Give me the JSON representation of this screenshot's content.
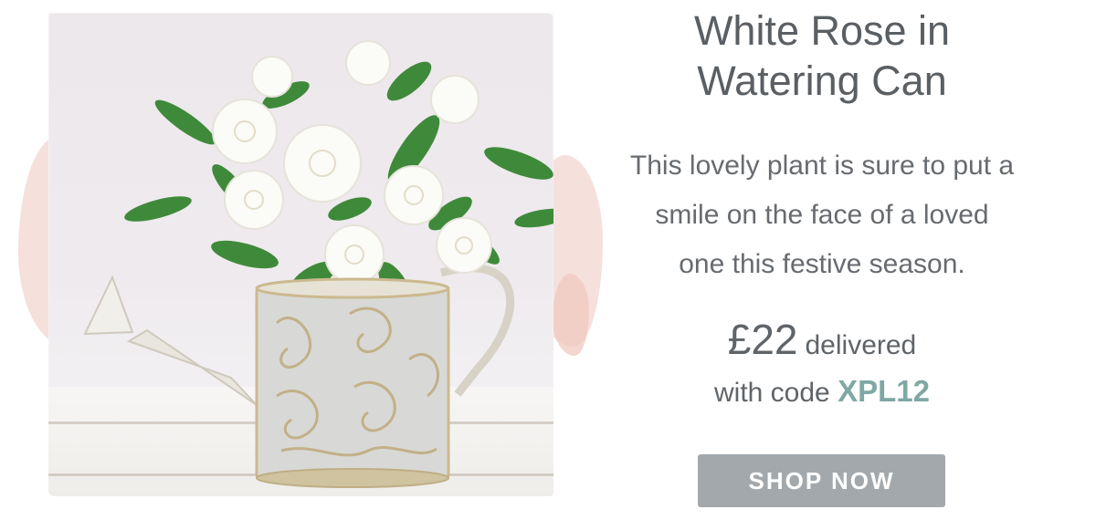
{
  "product": {
    "title_line1": "White Rose in",
    "title_line2": "Watering Can",
    "description_lines": [
      "This lovely plant is sure to put a",
      "smile on the face of a loved",
      "one this festive season."
    ],
    "price": "£22",
    "price_suffix": "delivered",
    "code_prefix": "with code",
    "code": "XPL12",
    "cta_label": "SHOP NOW"
  },
  "colors": {
    "text": "#5f6469",
    "code_accent": "#7fa8a4",
    "button_bg": "#a3a8ac",
    "wash_pink": "#f2d6cf"
  }
}
